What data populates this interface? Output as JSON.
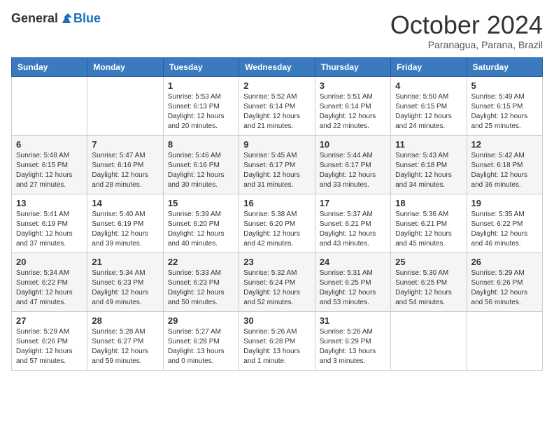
{
  "header": {
    "logo_general": "General",
    "logo_blue": "Blue",
    "month_title": "October 2024",
    "location": "Paranagua, Parana, Brazil"
  },
  "days_of_week": [
    "Sunday",
    "Monday",
    "Tuesday",
    "Wednesday",
    "Thursday",
    "Friday",
    "Saturday"
  ],
  "weeks": [
    [
      {
        "day": "",
        "info": ""
      },
      {
        "day": "",
        "info": ""
      },
      {
        "day": "1",
        "info": "Sunrise: 5:53 AM\nSunset: 6:13 PM\nDaylight: 12 hours and 20 minutes."
      },
      {
        "day": "2",
        "info": "Sunrise: 5:52 AM\nSunset: 6:14 PM\nDaylight: 12 hours and 21 minutes."
      },
      {
        "day": "3",
        "info": "Sunrise: 5:51 AM\nSunset: 6:14 PM\nDaylight: 12 hours and 22 minutes."
      },
      {
        "day": "4",
        "info": "Sunrise: 5:50 AM\nSunset: 6:15 PM\nDaylight: 12 hours and 24 minutes."
      },
      {
        "day": "5",
        "info": "Sunrise: 5:49 AM\nSunset: 6:15 PM\nDaylight: 12 hours and 25 minutes."
      }
    ],
    [
      {
        "day": "6",
        "info": "Sunrise: 5:48 AM\nSunset: 6:15 PM\nDaylight: 12 hours and 27 minutes."
      },
      {
        "day": "7",
        "info": "Sunrise: 5:47 AM\nSunset: 6:16 PM\nDaylight: 12 hours and 28 minutes."
      },
      {
        "day": "8",
        "info": "Sunrise: 5:46 AM\nSunset: 6:16 PM\nDaylight: 12 hours and 30 minutes."
      },
      {
        "day": "9",
        "info": "Sunrise: 5:45 AM\nSunset: 6:17 PM\nDaylight: 12 hours and 31 minutes."
      },
      {
        "day": "10",
        "info": "Sunrise: 5:44 AM\nSunset: 6:17 PM\nDaylight: 12 hours and 33 minutes."
      },
      {
        "day": "11",
        "info": "Sunrise: 5:43 AM\nSunset: 6:18 PM\nDaylight: 12 hours and 34 minutes."
      },
      {
        "day": "12",
        "info": "Sunrise: 5:42 AM\nSunset: 6:18 PM\nDaylight: 12 hours and 36 minutes."
      }
    ],
    [
      {
        "day": "13",
        "info": "Sunrise: 5:41 AM\nSunset: 6:19 PM\nDaylight: 12 hours and 37 minutes."
      },
      {
        "day": "14",
        "info": "Sunrise: 5:40 AM\nSunset: 6:19 PM\nDaylight: 12 hours and 39 minutes."
      },
      {
        "day": "15",
        "info": "Sunrise: 5:39 AM\nSunset: 6:20 PM\nDaylight: 12 hours and 40 minutes."
      },
      {
        "day": "16",
        "info": "Sunrise: 5:38 AM\nSunset: 6:20 PM\nDaylight: 12 hours and 42 minutes."
      },
      {
        "day": "17",
        "info": "Sunrise: 5:37 AM\nSunset: 6:21 PM\nDaylight: 12 hours and 43 minutes."
      },
      {
        "day": "18",
        "info": "Sunrise: 5:36 AM\nSunset: 6:21 PM\nDaylight: 12 hours and 45 minutes."
      },
      {
        "day": "19",
        "info": "Sunrise: 5:35 AM\nSunset: 6:22 PM\nDaylight: 12 hours and 46 minutes."
      }
    ],
    [
      {
        "day": "20",
        "info": "Sunrise: 5:34 AM\nSunset: 6:22 PM\nDaylight: 12 hours and 47 minutes."
      },
      {
        "day": "21",
        "info": "Sunrise: 5:34 AM\nSunset: 6:23 PM\nDaylight: 12 hours and 49 minutes."
      },
      {
        "day": "22",
        "info": "Sunrise: 5:33 AM\nSunset: 6:23 PM\nDaylight: 12 hours and 50 minutes."
      },
      {
        "day": "23",
        "info": "Sunrise: 5:32 AM\nSunset: 6:24 PM\nDaylight: 12 hours and 52 minutes."
      },
      {
        "day": "24",
        "info": "Sunrise: 5:31 AM\nSunset: 6:25 PM\nDaylight: 12 hours and 53 minutes."
      },
      {
        "day": "25",
        "info": "Sunrise: 5:30 AM\nSunset: 6:25 PM\nDaylight: 12 hours and 54 minutes."
      },
      {
        "day": "26",
        "info": "Sunrise: 5:29 AM\nSunset: 6:26 PM\nDaylight: 12 hours and 56 minutes."
      }
    ],
    [
      {
        "day": "27",
        "info": "Sunrise: 5:29 AM\nSunset: 6:26 PM\nDaylight: 12 hours and 57 minutes."
      },
      {
        "day": "28",
        "info": "Sunrise: 5:28 AM\nSunset: 6:27 PM\nDaylight: 12 hours and 59 minutes."
      },
      {
        "day": "29",
        "info": "Sunrise: 5:27 AM\nSunset: 6:28 PM\nDaylight: 13 hours and 0 minutes."
      },
      {
        "day": "30",
        "info": "Sunrise: 5:26 AM\nSunset: 6:28 PM\nDaylight: 13 hours and 1 minute."
      },
      {
        "day": "31",
        "info": "Sunrise: 5:26 AM\nSunset: 6:29 PM\nDaylight: 13 hours and 3 minutes."
      },
      {
        "day": "",
        "info": ""
      },
      {
        "day": "",
        "info": ""
      }
    ]
  ]
}
